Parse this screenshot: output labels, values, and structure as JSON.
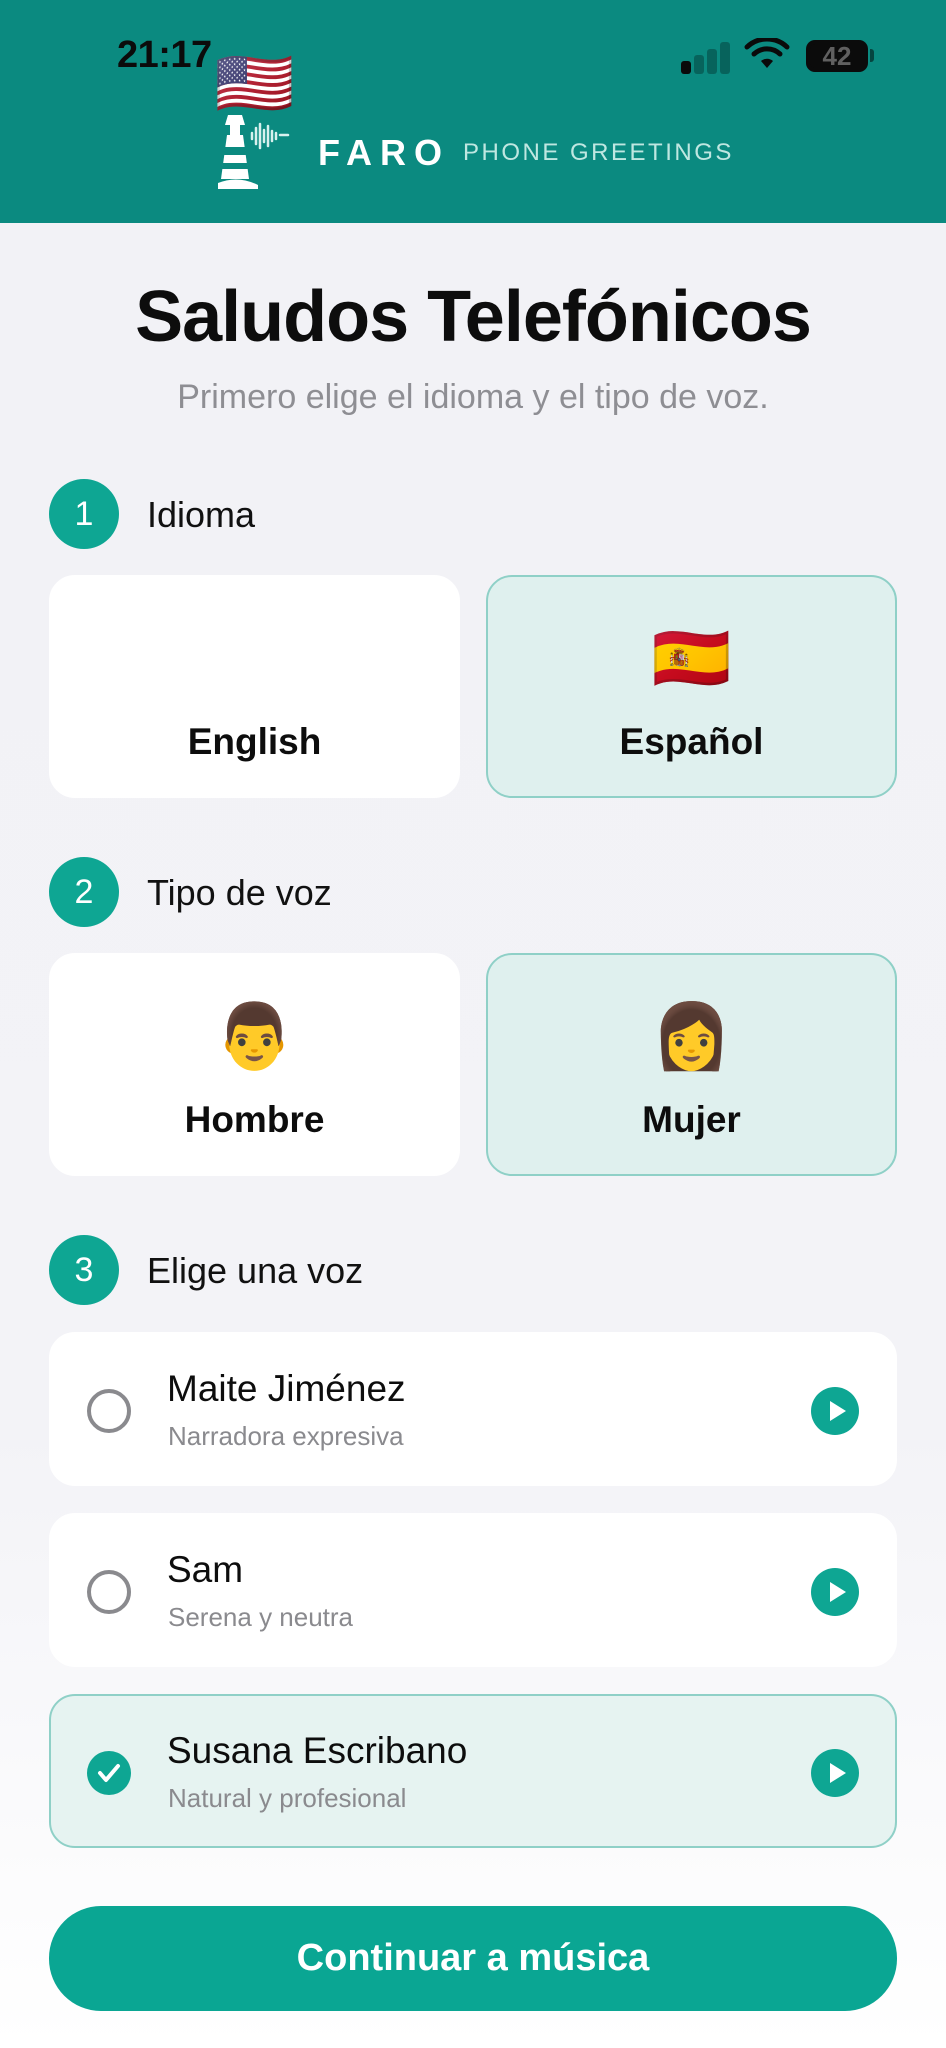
{
  "status_bar": {
    "time": "21:17",
    "battery": "42"
  },
  "brand": {
    "name": "FARO",
    "subtitle": "PHONE GREETINGS"
  },
  "page": {
    "title": "Saludos Telefónicos",
    "subtitle": "Primero elige el idioma y el tipo de voz."
  },
  "steps": [
    {
      "number": "1",
      "label": "Idioma"
    },
    {
      "number": "2",
      "label": "Tipo de voz"
    },
    {
      "number": "3",
      "label": "Elige una voz"
    }
  ],
  "languages": [
    {
      "emoji": "🇺🇸",
      "label": "English",
      "selected": false
    },
    {
      "emoji": "🇪🇸",
      "label": "Español",
      "selected": true
    }
  ],
  "voice_types": [
    {
      "emoji": "👨",
      "label": "Hombre",
      "selected": false
    },
    {
      "emoji": "👩",
      "label": "Mujer",
      "selected": true
    }
  ],
  "voices": [
    {
      "name": "Maite Jiménez",
      "description": "Narradora expresiva",
      "selected": false
    },
    {
      "name": "Sam",
      "description": "Serena y neutra",
      "selected": false
    },
    {
      "name": "Susana Escribano",
      "description": "Natural y profesional",
      "selected": true
    }
  ],
  "cta": {
    "label": "Continuar a música"
  },
  "icons": {
    "logo": "lighthouse-icon",
    "play": "play-icon",
    "check": "check-icon",
    "signal": "cellular-signal-icon",
    "wifi": "wifi-icon",
    "battery": "battery-icon"
  },
  "colors": {
    "header": "#0b8a80",
    "accent": "#0ea693",
    "selected_fill": "#dff0ee",
    "selected_border": "#8fd0c7"
  }
}
